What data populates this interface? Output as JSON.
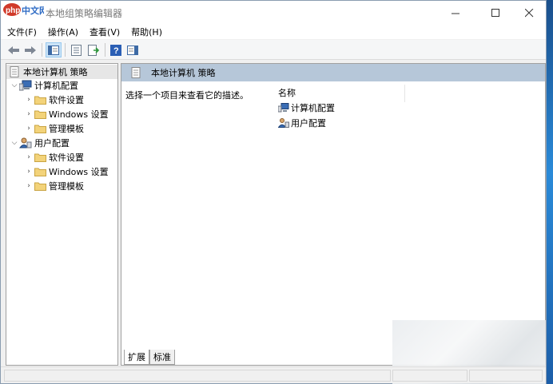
{
  "window": {
    "title": "本地组策略编辑器",
    "logo_text": "php中文网"
  },
  "menu": [
    "文件(F)",
    "操作(A)",
    "查看(V)",
    "帮助(H)"
  ],
  "toolbar": {
    "icons": [
      "back-arrow-icon",
      "forward-arrow-icon",
      "show-hide-tree-icon",
      "properties-icon",
      "export-list-icon",
      "help-icon",
      "show-hide-action-pane-icon"
    ]
  },
  "tree": {
    "root": "本地计算机 策略",
    "computer_config": "计算机配置",
    "user_config": "用户配置",
    "software_settings": "软件设置",
    "windows_settings": "Windows 设置",
    "admin_templates": "管理模板"
  },
  "right_pane": {
    "header": "本地计算机 策略",
    "description": "选择一个项目来查看它的描述。",
    "column_name": "名称",
    "items": [
      "计算机配置",
      "用户配置"
    ]
  },
  "tabs": {
    "extended": "扩展",
    "standard": "标准"
  },
  "colors": {
    "header_bg": "#b6c7d9",
    "logo_bg": "#2f6cc5",
    "folder": "#f3d37a"
  }
}
